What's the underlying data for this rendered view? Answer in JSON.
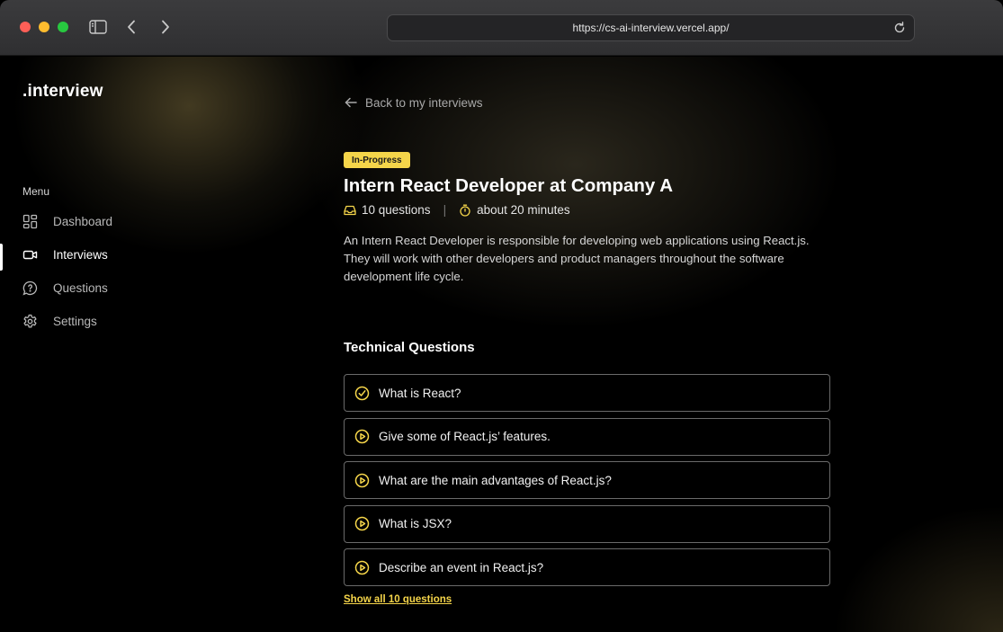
{
  "browser": {
    "url": "https://cs-ai-interview.vercel.app/"
  },
  "app": {
    "logo": ".interview"
  },
  "sidebar": {
    "menu_title": "Menu",
    "items": [
      {
        "label": "Dashboard",
        "icon": "dashboard-icon",
        "active": false
      },
      {
        "label": "Interviews",
        "icon": "video-icon",
        "active": true
      },
      {
        "label": "Questions",
        "icon": "question-bubble-icon",
        "active": false
      },
      {
        "label": "Settings",
        "icon": "gear-icon",
        "active": false
      }
    ]
  },
  "main": {
    "back_link": "Back to my interviews",
    "status_badge": "In-Progress",
    "title": "Intern React Developer at Company A",
    "question_count": "10 questions",
    "duration": "about 20 minutes",
    "description": "An Intern React Developer is responsible for developing web applications using React.js. They will work with other developers and product managers throughout the software development life cycle.",
    "section_title": "Technical Questions",
    "questions": [
      {
        "text": "What is React?",
        "status": "completed",
        "icon": "check-circle-icon"
      },
      {
        "text": "Give some of React.js’ features.",
        "status": "pending",
        "icon": "play-circle-icon"
      },
      {
        "text": "What are the main advantages of React.js?",
        "status": "pending",
        "icon": "play-circle-icon"
      },
      {
        "text": "What is JSX?",
        "status": "pending",
        "icon": "play-circle-icon"
      },
      {
        "text": "Describe an event in React.js?",
        "status": "pending",
        "icon": "play-circle-icon"
      }
    ],
    "show_all_link": "Show all 10 questions"
  },
  "colors": {
    "accent": "#f5d54a",
    "background": "#000000",
    "border": "#6a6a6a"
  }
}
